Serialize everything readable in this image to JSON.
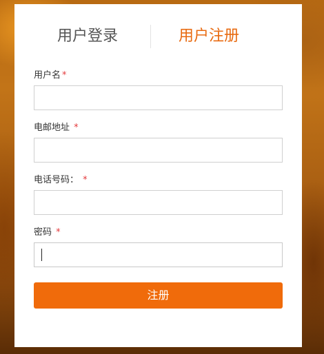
{
  "tabs": {
    "login": "用户登录",
    "register": "用户注册",
    "active": "register"
  },
  "form": {
    "username_label": "用户名",
    "email_label": "电邮地址",
    "phone_label": "电话号码：",
    "password_label": "密码",
    "required_mark": "*",
    "username_value": "",
    "email_value": "",
    "phone_value": "",
    "password_value": "",
    "submit_label": "注册"
  },
  "colors": {
    "accent": "#f06b0b",
    "active_tab": "#e86a10",
    "required": "#e4393c"
  }
}
